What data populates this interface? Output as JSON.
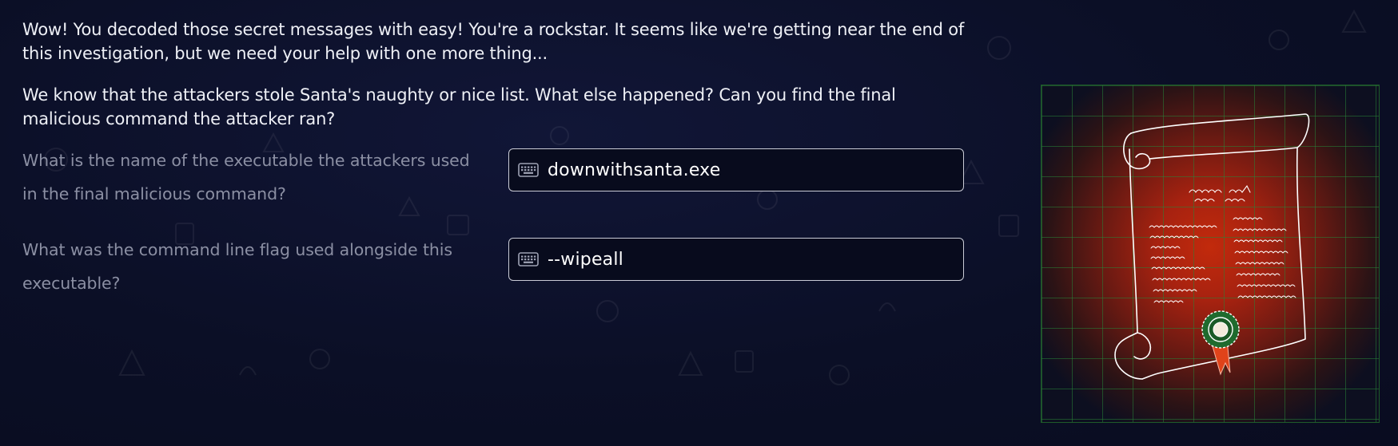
{
  "intro": {
    "paragraph1": "Wow! You decoded those secret messages with easy! You're a rockstar. It seems like we're getting near the end of this investigation, but we need your help with one more thing...",
    "paragraph2": "We know that the attackers stole Santa's naughty or nice list. What else happened? Can you find the final malicious command the attacker ran?"
  },
  "questions": [
    {
      "label": "What is the name of the executable the attackers used in the final malicious command?",
      "answer": "downwithsanta.exe",
      "icon": "keyboard-icon"
    },
    {
      "label": "What was the command line flag used alongside this executable?",
      "answer": "--wipeall",
      "icon": "keyboard-icon"
    }
  ],
  "illustration": {
    "subject": "scroll-list-with-seal",
    "colors": {
      "glow": "#c22a0c",
      "grid": "#28823a",
      "seal": "#1f6b2e",
      "ribbon": "#e0431a"
    }
  }
}
